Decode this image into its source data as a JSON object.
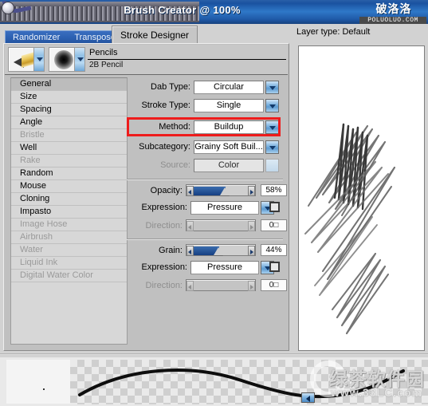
{
  "window": {
    "title": "Brush Creator @ 100%",
    "watermark_top": "破洛洛",
    "watermark_top_url": "POLUOLUO.COM"
  },
  "tabs": {
    "inactive": [
      "Randomizer",
      "Transposer"
    ],
    "active": "Stroke Designer"
  },
  "brush_header": {
    "category": "Pencils",
    "variant": "2B Pencil",
    "pencil_icon": "pencil-icon",
    "dab_icon": "dab-preview-icon"
  },
  "category_list": [
    {
      "label": "General",
      "state": "selected"
    },
    {
      "label": "Size",
      "state": "enabled"
    },
    {
      "label": "Spacing",
      "state": "enabled"
    },
    {
      "label": "Angle",
      "state": "enabled"
    },
    {
      "label": "Bristle",
      "state": "disabled"
    },
    {
      "label": "Well",
      "state": "enabled"
    },
    {
      "label": "Rake",
      "state": "disabled"
    },
    {
      "label": "Random",
      "state": "enabled"
    },
    {
      "label": "Mouse",
      "state": "enabled"
    },
    {
      "label": "Cloning",
      "state": "enabled"
    },
    {
      "label": "Impasto",
      "state": "enabled"
    },
    {
      "label": "Image Hose",
      "state": "disabled"
    },
    {
      "label": "Airbrush",
      "state": "disabled"
    },
    {
      "label": "Water",
      "state": "disabled"
    },
    {
      "label": "Liquid Ink",
      "state": "disabled"
    },
    {
      "label": "Digital Water Color",
      "state": "disabled"
    }
  ],
  "general": {
    "dab_type": {
      "label": "Dab Type:",
      "value": "Circular"
    },
    "stroke_type": {
      "label": "Stroke Type:",
      "value": "Single"
    },
    "method": {
      "label": "Method:",
      "value": "Buildup",
      "highlight_color": "#ee1c1c"
    },
    "subcategory": {
      "label": "Subcategory:",
      "value": "Grainy Soft Buil..."
    },
    "source": {
      "label": "Source:",
      "value": "Color",
      "state": "disabled"
    }
  },
  "opacity_group": {
    "slider": {
      "label": "Opacity:",
      "value": "58%",
      "percent": 58
    },
    "expression": {
      "label": "Expression:",
      "value": "Pressure"
    },
    "direction": {
      "label": "Direction:",
      "value": "0□",
      "state": "disabled"
    }
  },
  "grain_group": {
    "slider": {
      "label": "Grain:",
      "value": "44%",
      "percent": 44
    },
    "expression": {
      "label": "Expression:",
      "value": "Pressure"
    },
    "direction": {
      "label": "Direction:",
      "value": "0□",
      "state": "disabled"
    }
  },
  "canvas_panel": {
    "layer_type": "Layer type: Default"
  },
  "preview": {
    "watermark_cn": "绿茶软件园",
    "watermark_url": "www.33LC.com"
  }
}
